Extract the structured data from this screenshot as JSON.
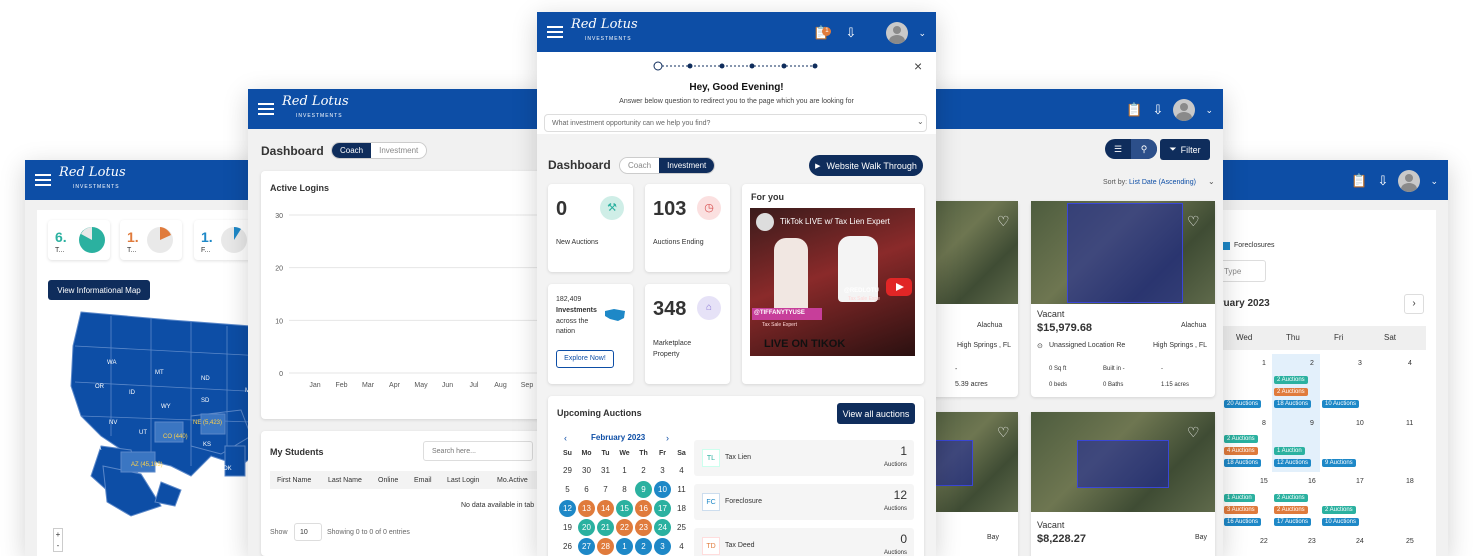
{
  "brand": {
    "name": "Red Lotus",
    "sub": "INVESTMENTS"
  },
  "colors": {
    "primary": "#0d4ea6",
    "dark": "#0f2d5c",
    "teal": "#2bb1a0",
    "orange": "#e07b3c",
    "cyan": "#1e88c7"
  },
  "win_map": {
    "stats": [
      {
        "value": "6.",
        "label": "T..."
      },
      {
        "value": "1.",
        "label": "T..."
      },
      {
        "value": "1.",
        "label": "F..."
      }
    ],
    "map_button": "View Informational Map",
    "states": [
      "WA",
      "OR",
      "CA",
      "MT",
      "ID",
      "WY",
      "NV",
      "UT",
      "AZ",
      "CO",
      "NM",
      "ND",
      "SD",
      "NE",
      "KS",
      "OK",
      "TX",
      "MN",
      "IA",
      "MO",
      "AK",
      "HI"
    ],
    "callouts": {
      "ne": "NE (5,423)",
      "co": "CO (440)",
      "az": "AZ (45,103)"
    },
    "zoom_in": "+",
    "zoom_out": "-"
  },
  "win_dash": {
    "title": "Dashboard",
    "toggle": [
      "Coach",
      "Investment"
    ],
    "logins_title": "Active Logins",
    "y_ticks": [
      "30",
      "20",
      "10",
      "0"
    ],
    "x_ticks": [
      "Jan",
      "Feb",
      "Mar",
      "Apr",
      "May",
      "Jun",
      "Jul",
      "Aug",
      "Sep"
    ],
    "students_title": "My Students",
    "search_placeholder": "Search here...",
    "columns": [
      "First Name",
      "Last Name",
      "Online",
      "Email",
      "Last Login",
      "Mo.Active"
    ],
    "empty": "No data available in tab",
    "show": "Show",
    "page_size": "10",
    "showing": "Showing 0 to 0 of 0 entries"
  },
  "win_listings": {
    "sort_label": "Sort by:",
    "sort_value": "List Date (Ascending)",
    "filter": "Filter",
    "cards": [
      {
        "county": "Alachua",
        "city": "High Springs , FL",
        "lot": "-",
        "acres": "5.39 acres",
        "show_price": false
      },
      {
        "type": "Vacant",
        "price": "$15,979.68",
        "county": "Alachua",
        "location": "Unassigned Location Re",
        "city": "High Springs , FL",
        "sqft": "0 Sq ft",
        "built": "Built in -",
        "beds": "0 beds",
        "baths": "0 Baths",
        "lot": "-",
        "acres": "1.15 acres",
        "show_price": true
      },
      {
        "county": "Bay",
        "show_price": false
      },
      {
        "type": "Vacant",
        "price": "$8,228.27",
        "county": "Bay",
        "show_price": true
      }
    ]
  },
  "win_calendar": {
    "legend_tail": "ed",
    "legend_item": "Foreclosures",
    "auction_type": "tion Type",
    "month": "ebruary 2023",
    "next": "›",
    "days": [
      "Wed",
      "Thu",
      "Fri",
      "Sat"
    ],
    "rows": [
      {
        "dates": [
          "1",
          "2",
          "3",
          "4"
        ]
      },
      {
        "dates": [
          "8",
          "9",
          "10",
          "11"
        ]
      },
      {
        "dates": [
          "15",
          "16",
          "17",
          "18"
        ]
      },
      {
        "dates": [
          "22",
          "23",
          "24",
          "25"
        ]
      }
    ],
    "chips": {
      "r1_thu_a": "2 Auctions",
      "r1_thu_b": "2 Auctions",
      "r1_thu_c": "18 Auctions",
      "r1_wed": "20 Auctions",
      "r1_fri": "10 Auctions",
      "r2_wed_a": "2 Auctions",
      "r2_wed_b": "4 Auctions",
      "r2_wed_c": "18 Auctions",
      "r2_thu_a": "1 Auction",
      "r2_thu_b": "12 Auctions",
      "r2_fri": "9 Auctions",
      "r3_wed_a": "1 Auction",
      "r3_wed_b": "3 Auctions",
      "r3_wed_c": "16 Auctions",
      "r3_thu_a": "2 Auctions",
      "r3_thu_b": "2 Auctions",
      "r3_thu_c": "17 Auctions",
      "r3_fri_a": "2 Auctions",
      "r3_fri_b": "10 Auctions"
    }
  },
  "win_main": {
    "close": "×",
    "greeting": "Hey, Good Evening!",
    "instruction": "Answer below question to redirect you to the page which you are looking for",
    "question_placeholder": "What investment opportunity can we help you find?",
    "badge": "1",
    "title": "Dashboard",
    "toggle": [
      "Coach",
      "Investment"
    ],
    "walkthrough": "Website Walk Through",
    "stats": [
      {
        "value": "0",
        "label": "New Auctions"
      },
      {
        "value": "103",
        "label": "Auctions Ending"
      },
      {
        "value": "348",
        "label": "Marketplace Property"
      }
    ],
    "investments": {
      "count": "182,409",
      "bold": "Investments",
      "rest": "across the nation",
      "button": "Explore Now!"
    },
    "for_you": "For you",
    "video_title": "TikTok LIVE w/ Tax Lien Expert",
    "video_handle1": "@REDLOTU",
    "video_handle1_sub": "Tax Sale Expe",
    "video_handle2": "@TIFFANYTYUSE",
    "video_handle2_sub": "Tax Sale Expert",
    "video_banner": "LIVE ON TIKOK",
    "upcoming_title": "Upcoming Auctions",
    "view_all": "View all auctions",
    "cal_month": "February 2023",
    "cal_prev": "‹",
    "cal_next": "›",
    "cal_days": [
      "Su",
      "Mo",
      "Tu",
      "We",
      "Th",
      "Fr",
      "Sa"
    ],
    "cal_rows": [
      [
        "29",
        "30",
        "31",
        "1",
        "2",
        "3",
        "4"
      ],
      [
        "5",
        "6",
        "7",
        "8",
        "9",
        "10",
        "11"
      ],
      [
        "12",
        "13",
        "14",
        "15",
        "16",
        "17",
        "18"
      ],
      [
        "19",
        "20",
        "21",
        "22",
        "23",
        "24",
        "25"
      ],
      [
        "26",
        "27",
        "28",
        "1",
        "2",
        "3",
        "4"
      ]
    ],
    "auction_types": [
      {
        "abbr": "TL",
        "name": "Tax Lien",
        "count": "1",
        "unit": "Auctions"
      },
      {
        "abbr": "FC",
        "name": "Foreclosure",
        "count": "12",
        "unit": "Auctions"
      },
      {
        "abbr": "TD",
        "name": "Tax Deed",
        "count": "0",
        "unit": "Auctions"
      }
    ]
  }
}
